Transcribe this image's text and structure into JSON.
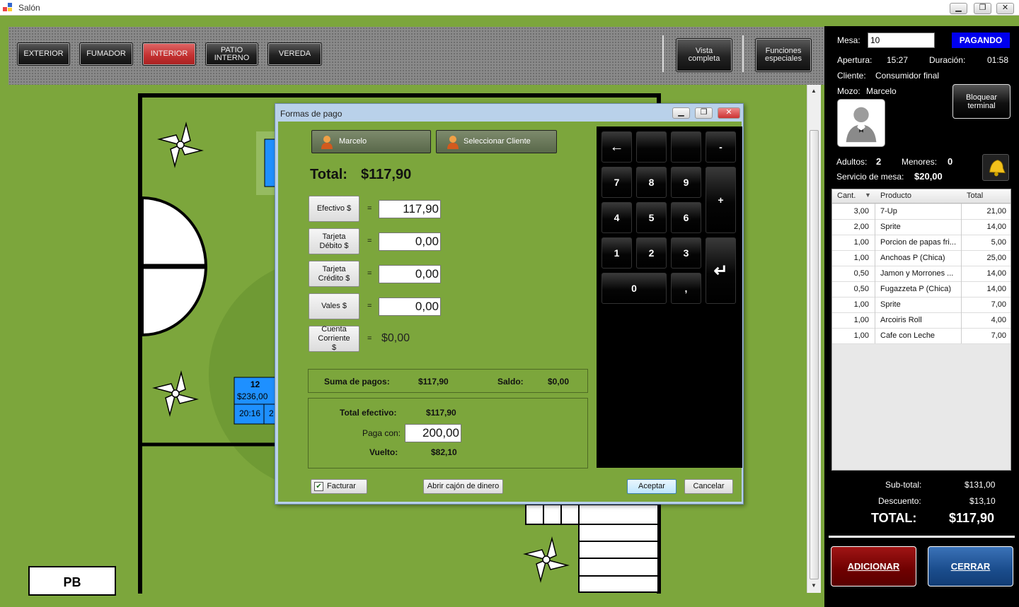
{
  "window": {
    "title": "Salón",
    "min_label": "▁",
    "restore_label": "❐",
    "close_label": "✕"
  },
  "toolbar": {
    "zones": [
      {
        "label": "EXTERIOR"
      },
      {
        "label": "FUMADOR"
      },
      {
        "label": "INTERIOR",
        "active": true
      },
      {
        "label": "PATIO INTERNO"
      },
      {
        "label": "VEREDA"
      }
    ],
    "vista_completa": "Vista completa",
    "funciones_especiales": "Funciones especiales"
  },
  "floor": {
    "level_label": "PB",
    "table12": {
      "number": "12",
      "amount": "$236,00",
      "time": "20:16",
      "extra": "2"
    }
  },
  "right_panel": {
    "mesa_label": "Mesa:",
    "mesa_value": "10",
    "status": "PAGANDO",
    "apertura_label": "Apertura:",
    "apertura_value": "15:27",
    "duracion_label": "Duración:",
    "duracion_value": "01:58",
    "cliente_label": "Cliente:",
    "cliente_value": "Consumidor final",
    "mozo_label": "Mozo:",
    "mozo_value": "Marcelo",
    "bloquear_label": "Bloquear terminal",
    "adultos_label": "Adultos:",
    "adultos_value": "2",
    "menores_label": "Menores:",
    "menores_value": "0",
    "servicio_label": "Servicio de mesa:",
    "servicio_value": "$20,00",
    "columns": {
      "cant": "Cant.",
      "producto": "Producto",
      "total": "Total"
    },
    "items": [
      {
        "cant": "3,00",
        "producto": "7-Up",
        "total": "21,00"
      },
      {
        "cant": "2,00",
        "producto": "Sprite",
        "total": "14,00"
      },
      {
        "cant": "1,00",
        "producto": "Porcion de papas fri...",
        "total": "5,00"
      },
      {
        "cant": "1,00",
        "producto": "Anchoas P (Chica)",
        "total": "25,00"
      },
      {
        "cant": "0,50",
        "producto": "Jamon y Morrones ...",
        "total": "14,00"
      },
      {
        "cant": "0,50",
        "producto": "Fugazzeta P (Chica)",
        "total": "14,00"
      },
      {
        "cant": "1,00",
        "producto": "Sprite",
        "total": "7,00"
      },
      {
        "cant": "1,00",
        "producto": "Arcoiris Roll",
        "total": "4,00"
      },
      {
        "cant": "1,00",
        "producto": "Cafe  con Leche",
        "total": "7,00"
      }
    ],
    "subtotal_label": "Sub-total:",
    "subtotal_value": "$131,00",
    "descuento_label": "Descuento:",
    "descuento_value": "$13,10",
    "total_label": "TOTAL:",
    "total_value": "$117,90",
    "adicionar_label": "ADICIONAR",
    "cerrar_label": "CERRAR"
  },
  "dialog": {
    "title": "Formas de pago",
    "mozo_button": "Marcelo",
    "cliente_button": "Seleccionar Cliente",
    "total_label": "Total:",
    "total_value": "$117,90",
    "payments": [
      {
        "label": "Efectivo $",
        "value": "117,90"
      },
      {
        "label": "Tarjeta Débito $",
        "value": "0,00"
      },
      {
        "label": "Tarjeta Crédito $",
        "value": "0,00"
      },
      {
        "label": "Vales $",
        "value": "0,00"
      }
    ],
    "cuenta_corriente_label": "Cuenta Corriente $",
    "cuenta_corriente_value": "$0,00",
    "equals": "=",
    "suma_label": "Suma de pagos:",
    "suma_value": "$117,90",
    "saldo_label": "Saldo:",
    "saldo_value": "$0,00",
    "total_efectivo_label": "Total efectivo:",
    "total_efectivo_value": "$117,90",
    "paga_con_label": "Paga con:",
    "paga_con_value": "200,00",
    "vuelto_label": "Vuelto:",
    "vuelto_value": "$82,10",
    "facturar_label": "Facturar",
    "facturar_checked": true,
    "abrir_cajon_label": "Abrir cajón de dinero",
    "aceptar_label": "Aceptar",
    "cancelar_label": "Cancelar",
    "keypad": {
      "back": "←",
      "minus": "-",
      "plus": "+",
      "enter": "↵",
      "dot": ",",
      "k7": "7",
      "k8": "8",
      "k9": "9",
      "k4": "4",
      "k5": "5",
      "k6": "6",
      "k1": "1",
      "k2": "2",
      "k3": "3",
      "k0": "0"
    }
  }
}
